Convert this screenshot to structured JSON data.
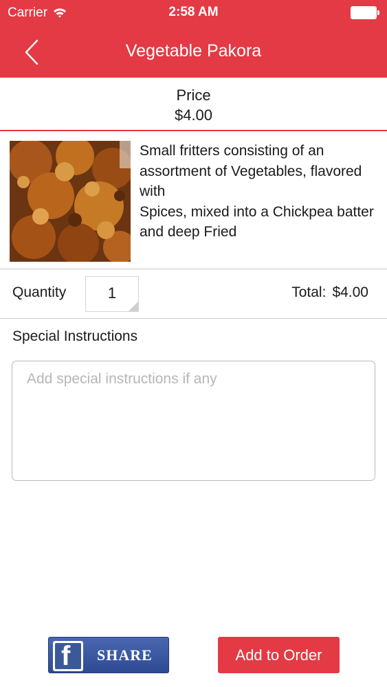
{
  "status_bar": {
    "carrier": "Carrier",
    "time": "2:58 AM"
  },
  "nav": {
    "title": "Vegetable Pakora",
    "back_icon": "chevron-left-icon"
  },
  "item": {
    "price_label": "Price",
    "price": "$4.00",
    "description": "Small fritters consisting of an assortment of Vegetables, flavored with\nSpices, mixed into a Chickpea batter and deep Fried"
  },
  "order": {
    "quantity_label": "Quantity",
    "quantity_value": "1",
    "total_label": "Total:",
    "total_value": "$4.00"
  },
  "instructions": {
    "label": "Special Instructions",
    "placeholder": "Add special instructions if any"
  },
  "actions": {
    "share_label": "SHARE",
    "add_to_order_label": "Add to Order"
  },
  "colors": {
    "brand_red": "#e33a45",
    "facebook_blue": "#3b5998"
  }
}
